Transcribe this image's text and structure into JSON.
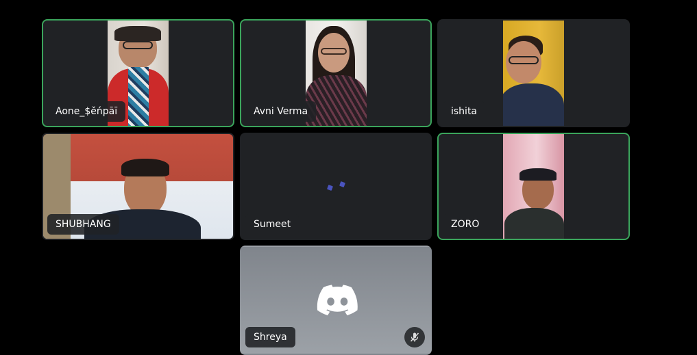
{
  "participants": [
    {
      "name": "Aone_$ěńpāī",
      "speaking": true,
      "video": true
    },
    {
      "name": "Avni Verma",
      "speaking": true,
      "video": true
    },
    {
      "name": "ishita",
      "speaking": false,
      "video": true
    },
    {
      "name": "SHUBHANG",
      "speaking": false,
      "video": true
    },
    {
      "name": "Sumeet",
      "speaking": false,
      "video": false,
      "state": "connecting"
    },
    {
      "name": "ZORO",
      "speaking": true,
      "video": true
    },
    {
      "name": "Shreya",
      "speaking": false,
      "video": false,
      "muted": true,
      "avatar": "discord-logo-icon"
    }
  ],
  "colors": {
    "background": "#000000",
    "tile": "#202225",
    "speaking_border": "#3ba55c",
    "shreya_tile": "#8e9297",
    "loading_dots": "#5865f2"
  },
  "icons": {
    "avatar": "discord-logo-icon",
    "mute": "mic-muted-icon",
    "loading": "loading-dots-icon"
  }
}
